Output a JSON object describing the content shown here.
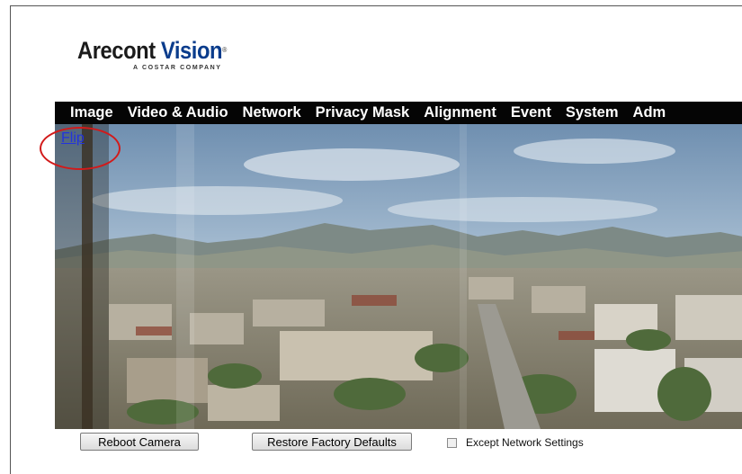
{
  "brand": {
    "name_part1": "Arecont ",
    "name_part2": "Vision",
    "registered": "®",
    "tagline": "A COSTAR COMPANY"
  },
  "nav": {
    "items": [
      "Image",
      "Video & Audio",
      "Network",
      "Privacy Mask",
      "Alignment",
      "Event",
      "System",
      "Adm"
    ]
  },
  "overlay": {
    "flip_link": "Flip"
  },
  "actions": {
    "reboot_label": "Reboot Camera",
    "restore_label": "Restore Factory Defaults",
    "except_network_label": "Except Network Settings",
    "except_network_checked": false
  },
  "colors": {
    "nav_bg": "#050505",
    "brand_blue": "#0a3c8c",
    "link": "#2233dd",
    "annotation": "#d21a1a"
  }
}
